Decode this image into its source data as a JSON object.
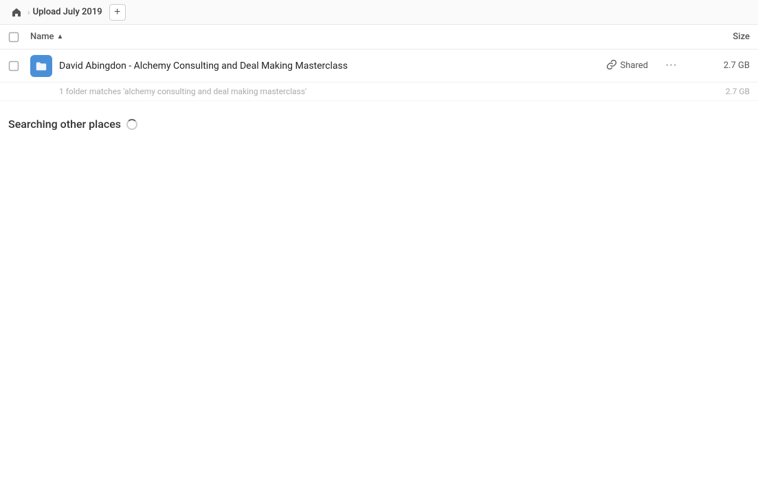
{
  "breadcrumb": {
    "home_label": "Home",
    "current_folder": "Upload July 2019",
    "add_button_label": "+"
  },
  "columns": {
    "name_label": "Name",
    "size_label": "Size",
    "sort_indicator": "▲"
  },
  "file_row": {
    "name": "David Abingdon - Alchemy Consulting and Deal Making Masterclass",
    "shared_label": "Shared",
    "size": "2.7 GB",
    "more_label": "···"
  },
  "match_info": {
    "text": "1 folder matches 'alchemy consulting and deal making masterclass'",
    "size": "2.7 GB"
  },
  "searching": {
    "label": "Searching other places"
  },
  "checkbox": {
    "unchecked": "☐"
  }
}
